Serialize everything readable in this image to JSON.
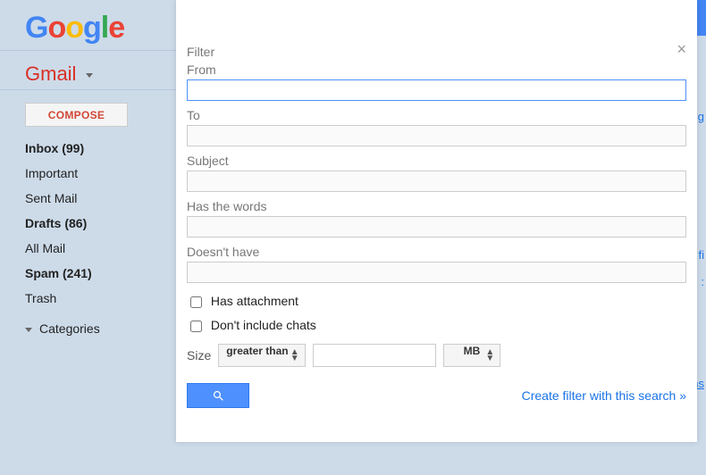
{
  "logo": {
    "g1": "G",
    "o1": "o",
    "o2": "o",
    "g2": "g",
    "l": "l",
    "e": "e"
  },
  "brand": "Gmail",
  "compose": "COMPOSE",
  "nav": {
    "inbox": "Inbox (99)",
    "important": "Important",
    "sent": "Sent Mail",
    "drafts": "Drafts (86)",
    "allmail": "All Mail",
    "spam": "Spam (241)",
    "trash": "Trash",
    "categories": "Categories"
  },
  "filter": {
    "title": "Filter",
    "from": "From",
    "to": "To",
    "subject": "Subject",
    "has_words": "Has the words",
    "doesnt_have": "Doesn't have",
    "has_attachment": "Has attachment",
    "dont_include_chats": "Don't include chats",
    "size_label": "Size",
    "size_op": "greater than",
    "size_unit": "MB",
    "create_link": "Create filter with this search »",
    "close": "×"
  },
  "bg_hints": {
    "a": "g",
    "b": "fi",
    "c": ":",
    "d": "ıns"
  }
}
